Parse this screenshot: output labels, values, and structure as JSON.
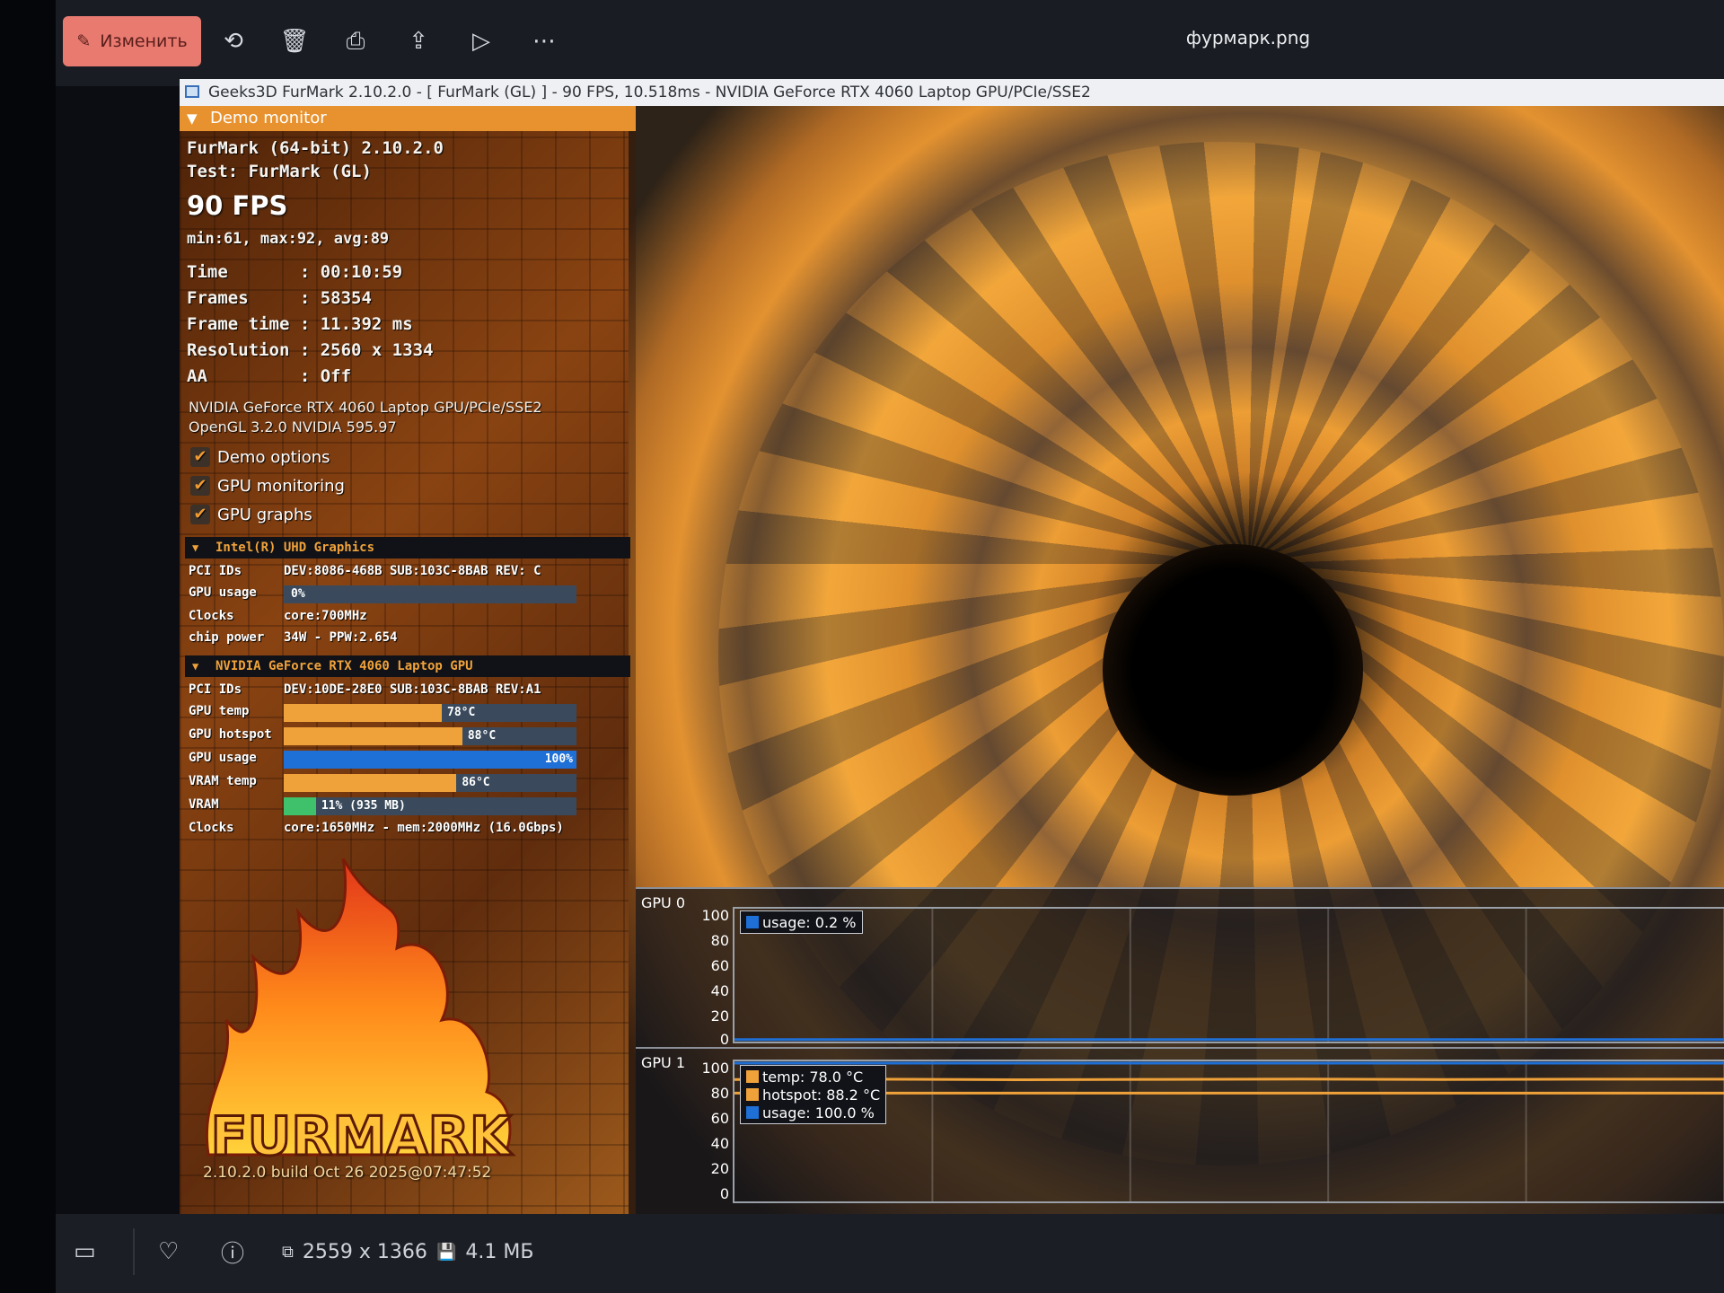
{
  "viewer": {
    "edit_label": "Изменить",
    "file_name": "фурмарк.png",
    "resolution": "2559 x 1366",
    "file_size": "4.1 МБ"
  },
  "furmark": {
    "window_title": "Geeks3D FurMark 2.10.2.0 - [ FurMark (GL) ] - 90 FPS, 10.518ms - NVIDIA GeForce RTX 4060 Laptop GPU/PCIe/SSE2",
    "panel_header": "Demo monitor",
    "app_line": "FurMark (64-bit) 2.10.2.0",
    "test_line": "Test: FurMark (GL)",
    "fps": "90 FPS",
    "fps_stats": "min:61, max:92, avg:89",
    "stats": [
      "Time       : 00:10:59",
      "Frames     : 58354",
      "Frame time : 11.392 ms",
      "Resolution : 2560 x 1334",
      "AA         : Off"
    ],
    "gpu_name": "NVIDIA GeForce RTX 4060 Laptop GPU/PCIe/SSE2",
    "opengl": "OpenGL 3.2.0 NVIDIA 595.97",
    "options": [
      "Demo options",
      "GPU monitoring",
      "GPU graphs"
    ],
    "gpu_a": {
      "title": "Intel(R) UHD Graphics",
      "pci_label": "PCI IDs",
      "pci": "DEV:8086-468B SUB:103C-8BAB REV: C",
      "usage_label": "GPU usage",
      "usage_text": "0%",
      "usage": 0,
      "clocks_label": "Clocks",
      "clocks": "core:700MHz",
      "power_label": "chip power",
      "power": "34W - PPW:2.654"
    },
    "gpu_b": {
      "title": "NVIDIA GeForce RTX 4060 Laptop GPU",
      "pci_label": "PCI IDs",
      "pci": "DEV:10DE-28E0 SUB:103C-8BAB REV:A1",
      "temp_label": "GPU temp",
      "temp_text": "78°C",
      "temp": 0.54,
      "hotspot_label": "GPU hotspot",
      "hotspot_text": "88°C",
      "hotspot": 0.61,
      "usage_label": "GPU usage",
      "usage_text": "100%",
      "usage": 1.0,
      "vram_temp_label": "VRAM temp",
      "vram_temp_text": "86°C",
      "vram_temp": 0.59,
      "vram_label": "VRAM",
      "vram_text": "11% (935 MB)",
      "vram": 0.11,
      "clocks_label": "Clocks",
      "clocks": "core:1650MHz - mem:2000MHz (16.0Gbps)"
    },
    "logo_text": "FURMARK",
    "build": "2.10.2.0 build Oct 26 2025@07:47:52",
    "colors": {
      "orange": "#f0a23a",
      "blue": "#1e6fd6",
      "green": "#3fc06a"
    }
  },
  "chart_data": [
    {
      "type": "line",
      "title": "GPU 0",
      "ylim": [
        0,
        100
      ],
      "yticks": [
        "100",
        "80",
        "60",
        "40",
        "20",
        "0"
      ],
      "series": [
        {
          "name": "usage: 0.2 %",
          "color": "#1e6fd6",
          "values": [
            0.2,
            0.2,
            0.2,
            0.2,
            0.2,
            0.2,
            0.2,
            0.2
          ]
        }
      ]
    },
    {
      "type": "line",
      "title": "GPU 1",
      "ylim": [
        0,
        100
      ],
      "yticks": [
        "100",
        "80",
        "60",
        "40",
        "20",
        "0"
      ],
      "series": [
        {
          "name": "temp: 78.0 °C",
          "color": "#f0a23a",
          "values": [
            78,
            78,
            78,
            78,
            78,
            78,
            78,
            78
          ]
        },
        {
          "name": "hotspot: 88.2 °C",
          "color": "#f0a23a",
          "values": [
            88,
            88.2,
            87.8,
            88.1,
            88.3,
            88,
            88.2,
            88.2
          ]
        },
        {
          "name": "usage: 100.0 %",
          "color": "#1e6fd6",
          "values": [
            100,
            100,
            100,
            100,
            100,
            100,
            100,
            100
          ]
        }
      ]
    }
  ]
}
